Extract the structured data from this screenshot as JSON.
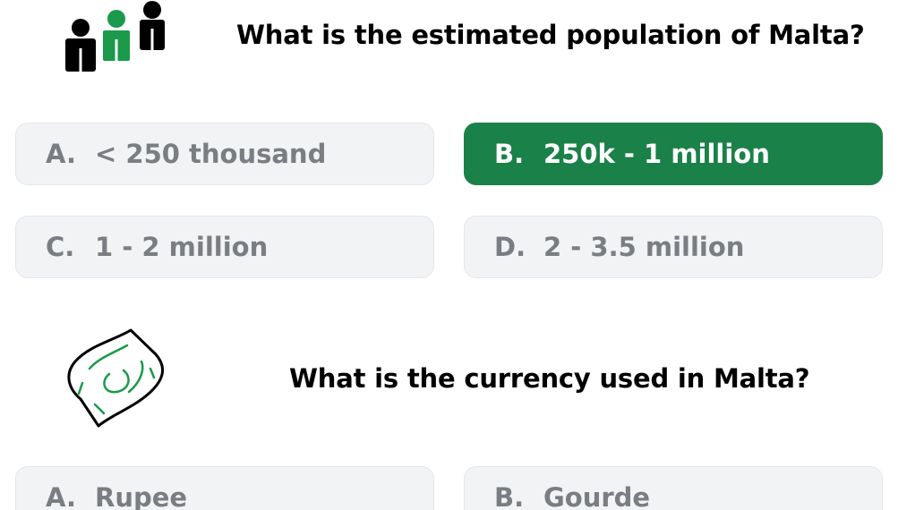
{
  "colors": {
    "selected_bg": "#1a8148",
    "option_bg": "#f2f3f5",
    "option_text": "#7a7d82",
    "icon_green": "#1a9a4a"
  },
  "questions": [
    {
      "icon": "people-icon",
      "text": "What is the estimated population of Malta?",
      "options": [
        {
          "letter": "A.",
          "label": "< 250 thousand",
          "selected": false
        },
        {
          "letter": "B.",
          "label": "250k - 1 million",
          "selected": true
        },
        {
          "letter": "C.",
          "label": "1 - 2 million",
          "selected": false
        },
        {
          "letter": "D.",
          "label": "2 - 3.5 million",
          "selected": false
        }
      ]
    },
    {
      "icon": "banknote-icon",
      "text": "What is the currency used in Malta?",
      "options": [
        {
          "letter": "A.",
          "label": "Rupee",
          "selected": false
        },
        {
          "letter": "B.",
          "label": "Gourde",
          "selected": false
        }
      ]
    }
  ]
}
